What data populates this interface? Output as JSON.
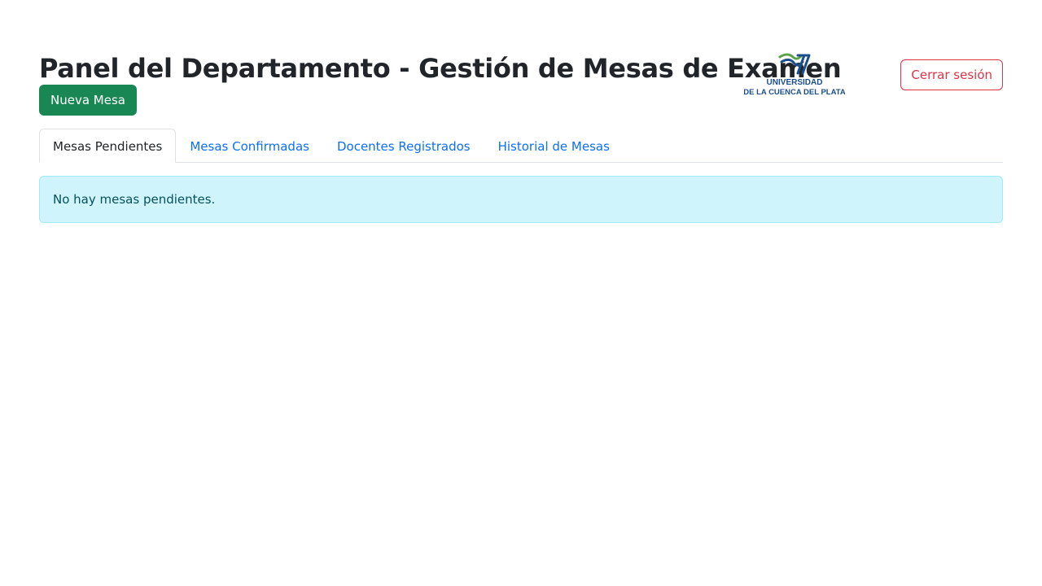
{
  "header": {
    "title": "Panel del Departamento - Gestión de Mesas de Examen",
    "logo": {
      "line1": "UNIVERSIDAD",
      "line2": "DE LA CUENCA DEL PLATA",
      "colors": {
        "blue": "#1b4e8c",
        "green": "#5aa34a"
      }
    },
    "logout_label": "Cerrar sesión"
  },
  "actions": {
    "new_label": "Nueva Mesa"
  },
  "tabs": [
    {
      "label": "Mesas Pendientes",
      "active": true
    },
    {
      "label": "Mesas Confirmadas",
      "active": false
    },
    {
      "label": "Docentes Registrados",
      "active": false
    },
    {
      "label": "Historial de Mesas",
      "active": false
    }
  ],
  "content": {
    "empty_message": "No hay mesas pendientes."
  },
  "colors": {
    "success": "#198754",
    "danger": "#dc3545",
    "link": "#0d6efd",
    "info_bg": "#cff4fc",
    "info_text": "#055160"
  }
}
